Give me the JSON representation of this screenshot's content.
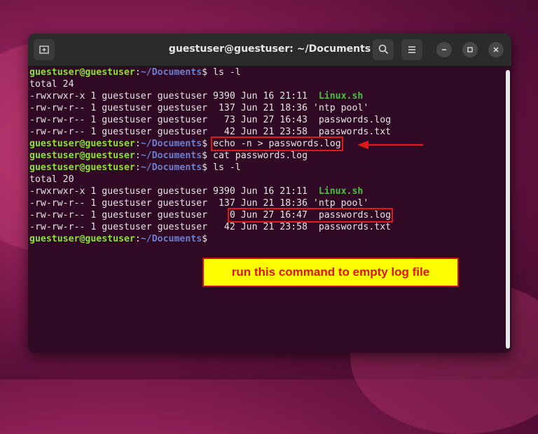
{
  "window": {
    "title": "guestuser@guestuser: ~/Documents",
    "new_tab_icon": "new-tab-icon",
    "search_icon": "search-icon",
    "menu_icon": "hamburger-menu-icon",
    "minimize_icon": "minimize-icon",
    "maximize_icon": "maximize-icon",
    "close_icon": "close-icon"
  },
  "prompt": {
    "user": "guestuser@guestuser",
    "sep": ":",
    "path": "~/Documents",
    "dollar": "$"
  },
  "terminal": {
    "cmd1": " ls -l",
    "total1": "total 24",
    "ls1": [
      {
        "prefix": "-rwxrwxr-x 1 guestuser guestuser 9390 Jun 16 21:11  ",
        "name": "Linux.sh"
      },
      {
        "prefix": "-rw-rw-r-- 1 guestuser guestuser  137 Jun 21 18:36 ",
        "name": "'ntp pool'"
      },
      {
        "prefix": "-rw-rw-r-- 1 guestuser guestuser   73 Jun 27 16:43  ",
        "name": "passwords.log"
      },
      {
        "prefix": "-rw-rw-r-- 1 guestuser guestuser   42 Jun 21 23:58  ",
        "name": "passwords.txt"
      }
    ],
    "cmd2": "echo -n > passwords.log",
    "cmd3": " cat passwords.log",
    "cmd4": " ls -l",
    "total2": "total 20",
    "ls2": [
      {
        "prefix": "-rwxrwxr-x 1 guestuser guestuser 9390 Jun 16 21:11  ",
        "name": "Linux.sh"
      },
      {
        "prefix": "-rw-rw-r-- 1 guestuser guestuser  137 Jun 21 18:36 ",
        "name": "'ntp pool'"
      },
      {
        "prefix": "-rw-rw-r-- 1 guestuser guestuser    ",
        "highlight": "0 Jun 27 16:47  passwords.log"
      },
      {
        "prefix": "-rw-rw-r-- 1 guestuser guestuser   42 Jun 21 23:58  ",
        "name": "passwords.txt"
      }
    ]
  },
  "annotation": {
    "callout": "run this command to empty log file",
    "accent": "#e01818",
    "callout_bg": "#ffff00"
  },
  "colors": {
    "terminal_bg": "#300a24",
    "prompt_user": "#8ae234",
    "prompt_path": "#6a7fd0",
    "executable": "#4ebf3f"
  }
}
